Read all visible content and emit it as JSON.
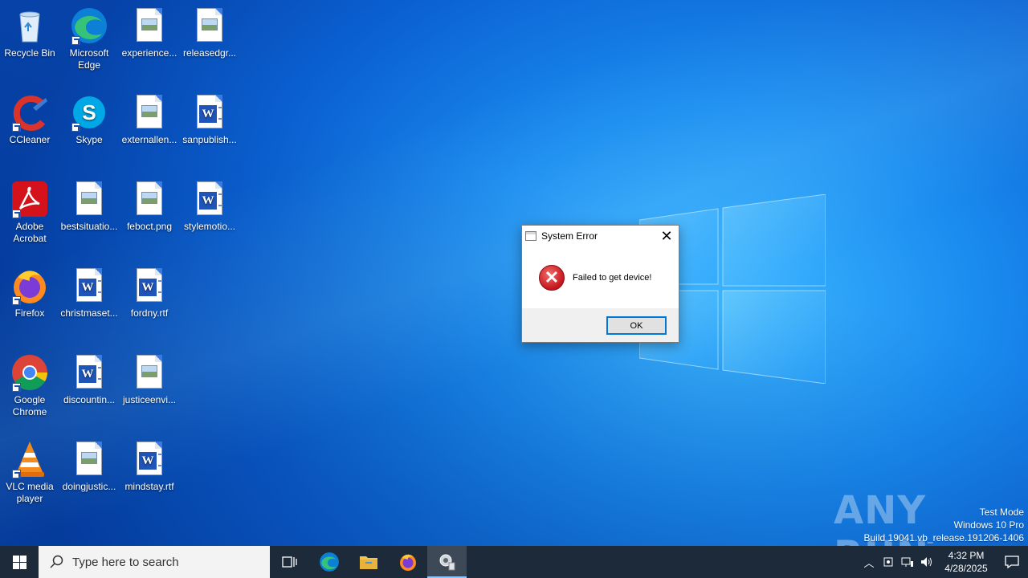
{
  "desktop": {
    "icons": [
      {
        "label": "Recycle Bin",
        "icon": "recycle-bin-icon"
      },
      {
        "label": "Microsoft Edge",
        "icon": "edge-icon"
      },
      {
        "label": "experience...",
        "icon": "image-file-icon"
      },
      {
        "label": "releasedgr...",
        "icon": "image-file-icon"
      },
      {
        "label": "CCleaner",
        "icon": "ccleaner-icon"
      },
      {
        "label": "Skype",
        "icon": "skype-icon"
      },
      {
        "label": "externallen...",
        "icon": "image-file-icon"
      },
      {
        "label": "sanpublish...",
        "icon": "word-file-icon"
      },
      {
        "label": "Adobe Acrobat",
        "icon": "acrobat-icon"
      },
      {
        "label": "bestsituatio...",
        "icon": "image-file-icon"
      },
      {
        "label": "feboct.png",
        "icon": "image-file-icon"
      },
      {
        "label": "stylemotio...",
        "icon": "word-file-icon"
      },
      {
        "label": "Firefox",
        "icon": "firefox-icon"
      },
      {
        "label": "christmaset...",
        "icon": "word-file-icon"
      },
      {
        "label": "fordny.rtf",
        "icon": "word-file-icon"
      },
      {
        "label": "Google Chrome",
        "icon": "chrome-icon"
      },
      {
        "label": "discountin...",
        "icon": "word-file-icon"
      },
      {
        "label": "justiceenvi...",
        "icon": "image-file-icon"
      },
      {
        "label": "VLC media player",
        "icon": "vlc-icon"
      },
      {
        "label": "doingjustic...",
        "icon": "image-file-icon"
      },
      {
        "label": "mindstay.rtf",
        "icon": "word-file-icon"
      }
    ]
  },
  "dialog": {
    "title": "System Error",
    "message": "Failed to get device!",
    "ok_label": "OK"
  },
  "watermark": {
    "brand": "ANY RUN",
    "test_mode": "Test Mode",
    "edition": "Windows 10 Pro",
    "build": "Build 19041.vb_release.191206-1406"
  },
  "taskbar": {
    "search_placeholder": "Type here to search",
    "time": "4:32 PM",
    "date": "4/28/2025"
  }
}
